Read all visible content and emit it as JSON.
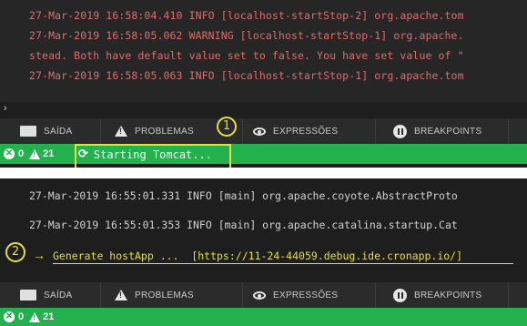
{
  "console_top": {
    "lines": [
      "27-Mar-2019 16:58:04.410 INFO [localhost-startStop-2] org.apache.tom",
      "27-Mar-2019 16:58:05.062 WARNING [localhost-startStop-1] org.apache.",
      "stead. Both have default value set to false. You have set value of \"",
      "27-Mar-2019 16:58:05.063 INFO [localhost-startStop-1] org.apache.tom"
    ],
    "prompt": "›"
  },
  "tabs": {
    "output": "SAÍDA",
    "problems": "PROBLEMAS",
    "expressions": "EXPRESSÕES",
    "breakpoints": "BREAKPOINTS"
  },
  "status_top": {
    "errors": "0",
    "warnings": "21",
    "message": "Starting Tomcat..."
  },
  "callouts": {
    "one": "1",
    "two": "2"
  },
  "console_bottom": {
    "lines": [
      "27-Mar-2019 16:55:01.331 INFO [main] org.apache.coyote.AbstractProto",
      "27-Mar-2019 16:55:01.353 INFO [main] org.apache.catalina.startup.Cat"
    ],
    "generate": "Generate hostApp ...  [https://11-24-44059.debug.ide.cronapp.io/]",
    "arrow": "→"
  },
  "status_bottom": {
    "errors": "0",
    "warnings": "21"
  },
  "colors": {
    "status_green": "#22b14c",
    "highlight_yellow": "#e6de3a",
    "log_red": "#e06b6b"
  }
}
